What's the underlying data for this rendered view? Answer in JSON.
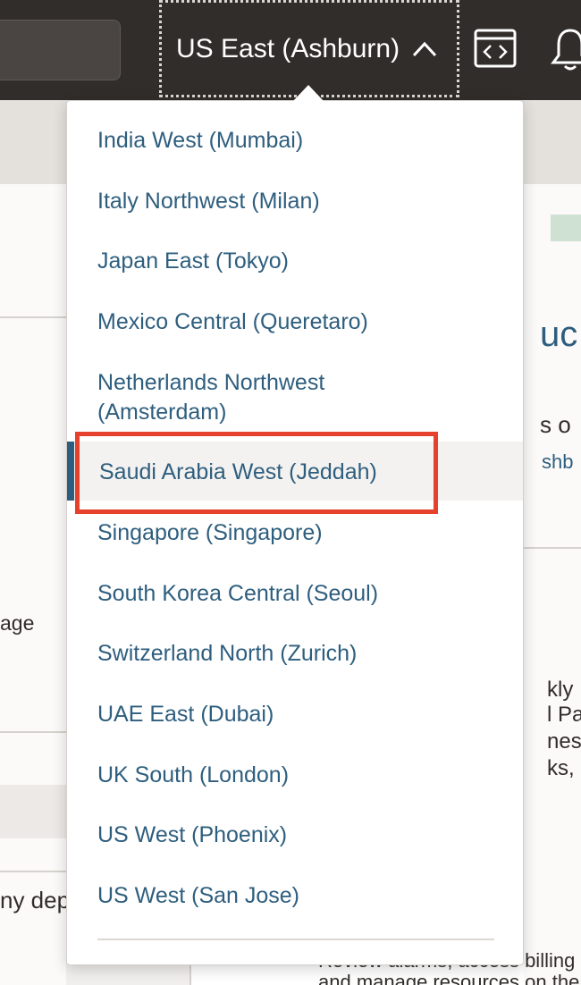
{
  "header": {
    "region_selector_label": "US East (Ashburn)",
    "icons": [
      "chevron-up-icon",
      "code-editor-icon",
      "bell-icon"
    ]
  },
  "region_dropdown": {
    "selected": "Saudi Arabia West (Jeddah)",
    "items": [
      "India West (Mumbai)",
      "Italy Northwest (Milan)",
      "Japan East (Tokyo)",
      "Mexico Central (Queretaro)",
      "Netherlands Northwest (Amsterdam)",
      "Saudi Arabia West (Jeddah)",
      "Singapore (Singapore)",
      "South Korea Central (Seoul)",
      "Switzerland North (Zurich)",
      "UAE East (Dubai)",
      "UK South (London)",
      "US West (Phoenix)",
      "US West (San Jose)"
    ]
  },
  "background": {
    "left_fragments": [
      "age",
      "ny dep"
    ],
    "right_fragments": [
      "uc",
      "s o",
      "shb",
      "kly",
      "l Pa",
      "ness",
      "ks,"
    ],
    "bottom_text_1": "Review alarms, access billing",
    "bottom_text_2": "and manage resources on the"
  },
  "colors": {
    "header_bg": "#312d2a",
    "link": "#2e5e7e",
    "highlight": "#e5412d"
  }
}
